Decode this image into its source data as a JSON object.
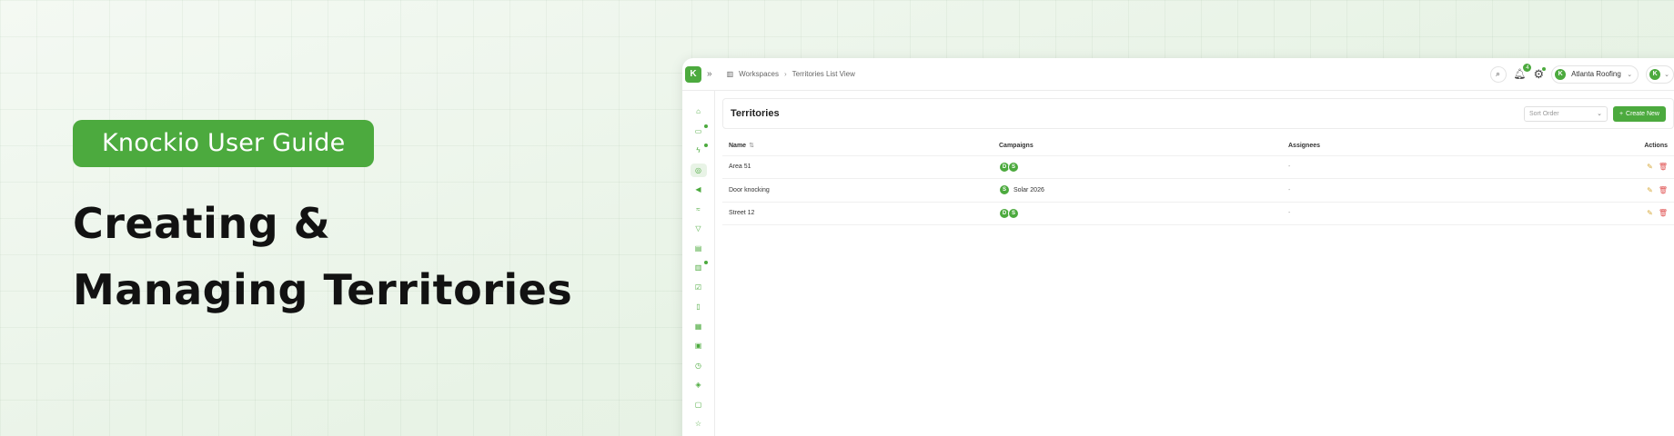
{
  "hero": {
    "badge": "Knockio User Guide",
    "line1": "Creating &",
    "line2": "Managing Territories"
  },
  "app": {
    "logo_letter": "K",
    "breadcrumb": [
      "Workspaces",
      "Territories List View"
    ],
    "notification_count": "4",
    "company": "Atlanta Roofing",
    "user_letter": "K",
    "page_title": "Territories",
    "sort_placeholder": "Sort Order",
    "create_label": "Create New",
    "columns": [
      "Name",
      "Campaigns",
      "Assignees",
      "Actions"
    ],
    "rows": [
      {
        "name": "Area 51",
        "campaign_chips": [
          "D",
          "S"
        ],
        "campaign_label": "",
        "assignees": "-"
      },
      {
        "name": "Door knocking",
        "campaign_chips": [
          "S"
        ],
        "campaign_label": "Solar 2026",
        "assignees": "-"
      },
      {
        "name": "Street 12",
        "campaign_chips": [
          "D",
          "S"
        ],
        "campaign_label": "",
        "assignees": "-"
      }
    ],
    "sidebar_icons": [
      "home-icon",
      "briefcase-icon",
      "lightning-icon",
      "globe-icon",
      "megaphone-icon",
      "handshake-icon",
      "filter-icon",
      "inbox-icon",
      "bar-chart-icon",
      "checkbox-icon",
      "clipboard-icon",
      "grid-icon",
      "calendar-icon",
      "compass-icon",
      "target-icon",
      "document-icon",
      "star-icon"
    ],
    "accent_color": "#4caa3e"
  }
}
